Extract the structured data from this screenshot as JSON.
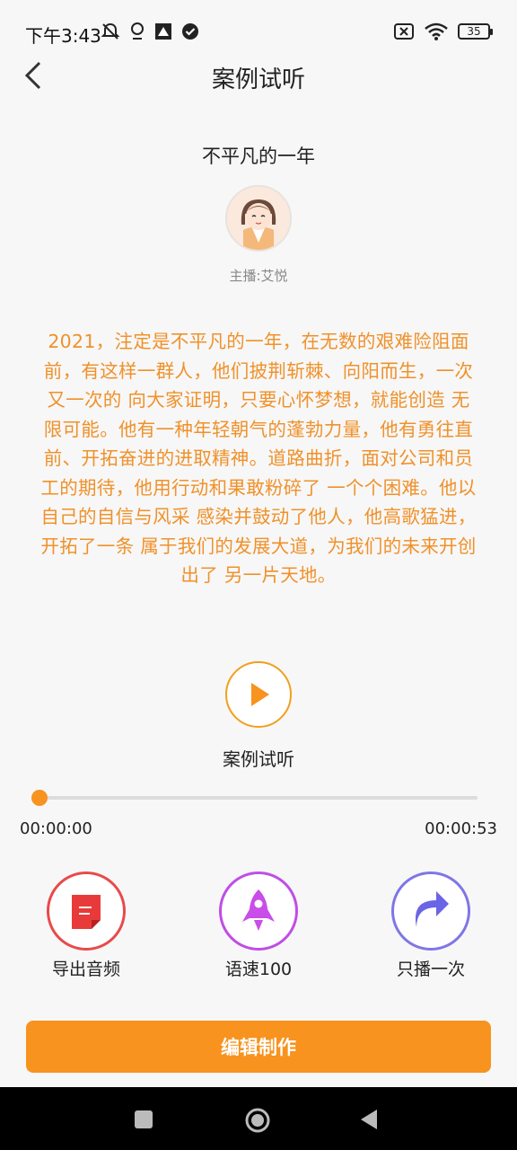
{
  "status_bar": {
    "time": "下午3:43",
    "battery": "35",
    "left_icons": [
      "mute-bell-icon",
      "location-icon",
      "app-icon",
      "check-circle-icon"
    ],
    "right_icons": [
      "no-sim-icon",
      "wifi-icon",
      "battery-icon"
    ]
  },
  "header": {
    "title": "案例试听",
    "back_icon": "chevron-left-icon"
  },
  "work": {
    "title": "不平凡的一年",
    "anchor": "主播:艾悦",
    "story_lines": [
      "2021，注定是不平凡的一年，在无数的艰难险阻面",
      "前，有这样一群人，他们披荆斩棘、向阳而生，一次",
      "又一次的 向大家证明，只要心怀梦想，就能创造 无",
      "限可能。他有一种年轻朝气的蓬勃力量，他有勇往直",
      "前、开拓奋进的进取精神。道路曲折，面对公司和员",
      "工的期待，他用行动和果敢粉碎了 一个个困难。他以",
      "自己的自信与风采 感染并鼓动了他人，他高歌猛进，",
      "开拓了一条 属于我们的发展大道，为我们的未来开创",
      "出了 另一片天地。"
    ]
  },
  "player": {
    "play_label": "案例试听",
    "current_time": "00:00:00",
    "total_time": "00:00:53",
    "progress": 0
  },
  "actions": [
    {
      "label": "导出音频",
      "icon": "document-icon",
      "color": "#e84a4a"
    },
    {
      "label": "语速100",
      "icon": "rocket-icon",
      "color": "#c04de6"
    },
    {
      "label": "只播一次",
      "icon": "redo-arrow-icon",
      "color": "#7f76e6"
    }
  ],
  "edit_button": "编辑制作",
  "colors": {
    "accent": "#f7931e",
    "story_text": "#f0912a"
  }
}
